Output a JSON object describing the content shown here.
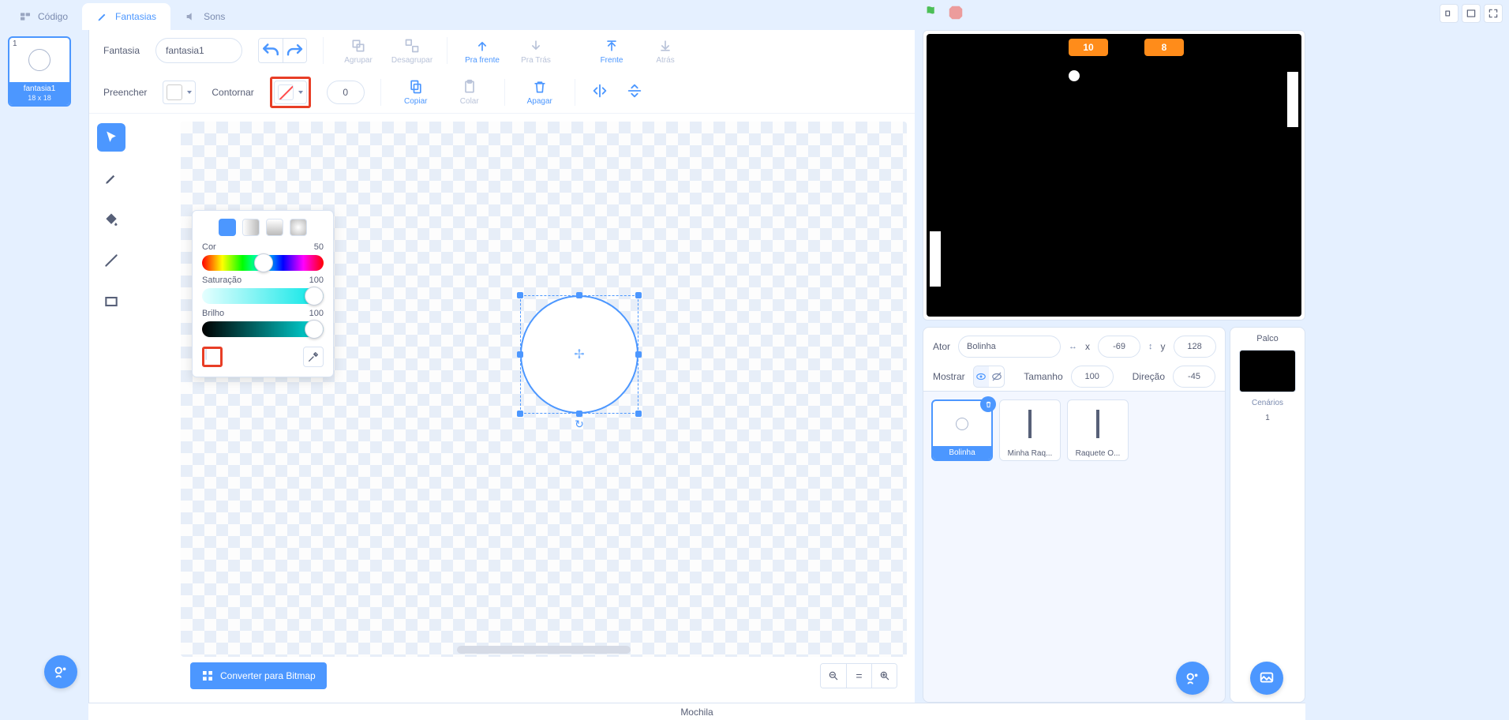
{
  "tabs": {
    "code": "Código",
    "costumes": "Fantasias",
    "sounds": "Sons"
  },
  "costume_list": {
    "number": "1",
    "name": "fantasia1",
    "size": "18 x 18"
  },
  "paint": {
    "costume_label": "Fantasia",
    "costume_name": "fantasia1",
    "group": "Agrupar",
    "ungroup": "Desagrupar",
    "forward": "Pra frente",
    "backward": "Pra Trás",
    "front": "Frente",
    "back": "Atrás",
    "fill_label": "Preencher",
    "outline_label": "Contornar",
    "outline_width": "0",
    "copy": "Copiar",
    "paste": "Colar",
    "delete": "Apagar",
    "convert": "Converter para Bitmap"
  },
  "color_pop": {
    "hue_label": "Cor",
    "hue_val": "50",
    "sat_label": "Saturação",
    "sat_val": "100",
    "bri_label": "Brilho",
    "bri_val": "100"
  },
  "stage": {
    "score_left": "10",
    "score_right": "8"
  },
  "sprite_info": {
    "actor_label": "Ator",
    "actor_name": "Bolinha",
    "x_label": "x",
    "x_val": "-69",
    "y_label": "y",
    "y_val": "128",
    "show_label": "Mostrar",
    "size_label": "Tamanho",
    "size_val": "100",
    "dir_label": "Direção",
    "dir_val": "-45"
  },
  "sprites": {
    "s1": "Bolinha",
    "s2": "Minha Raq...",
    "s3": "Raquete O..."
  },
  "stage_panel": {
    "title": "Palco",
    "backdrops_label": "Cenários",
    "backdrops_count": "1"
  },
  "backpack": "Mochila"
}
